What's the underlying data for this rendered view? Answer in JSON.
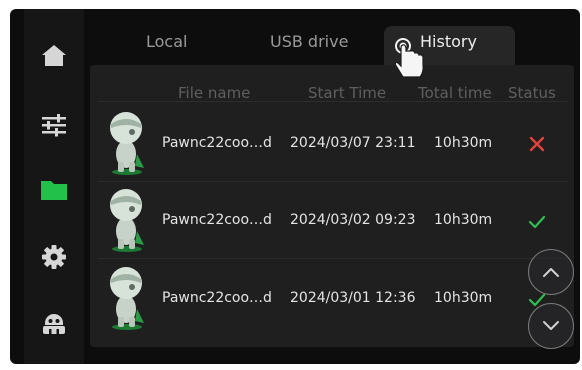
{
  "sidebar": {
    "items": [
      {
        "name": "home-icon"
      },
      {
        "name": "sliders-icon"
      },
      {
        "name": "folder-icon",
        "active": true
      },
      {
        "name": "gear-icon"
      },
      {
        "name": "robot-icon"
      }
    ],
    "active_color": "#22c24a",
    "icon_color": "#d6d6d6"
  },
  "tabs": [
    {
      "label": "Local"
    },
    {
      "label": "USB drive"
    },
    {
      "label": "History",
      "active": true
    }
  ],
  "table": {
    "columns": [
      "File name",
      "Start Time",
      "Total time",
      "Status"
    ],
    "rows": [
      {
        "file": "Pawnc22coo…d",
        "start": "2024/03/07 23:11",
        "total": "10h30m",
        "status": "failed-icon"
      },
      {
        "file": "Pawnc22coo…d",
        "start": "2024/03/02 09:23",
        "total": "10h30m",
        "status": "success-icon"
      },
      {
        "file": "Pawnc22coo…d",
        "start": "2024/03/01 12:36",
        "total": "10h30m",
        "status": "success-icon"
      }
    ]
  },
  "colors": {
    "fail": "#e2423a",
    "success": "#2fbf4f"
  },
  "scroll": {
    "up_icon": "chevron-up-icon",
    "down_icon": "chevron-down-icon"
  }
}
